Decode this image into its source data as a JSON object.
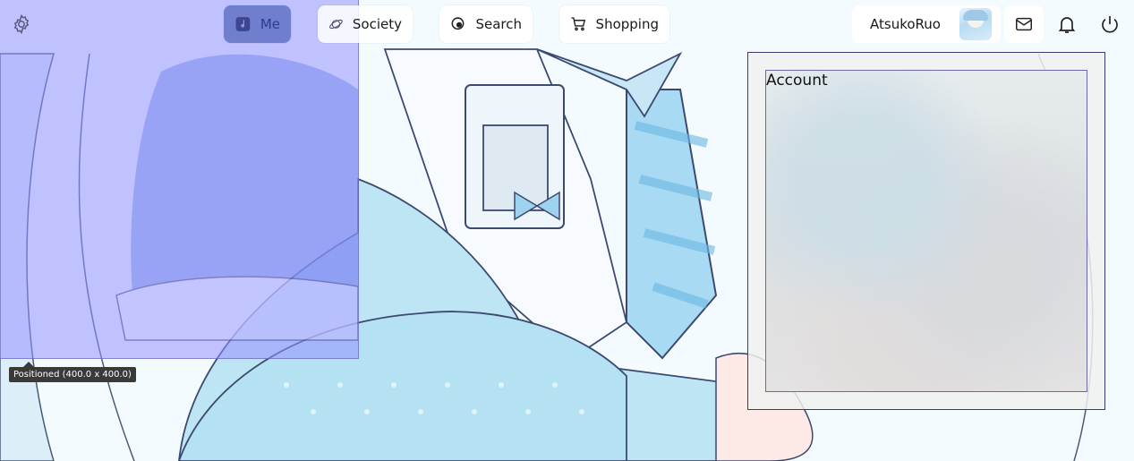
{
  "nav": {
    "items": [
      {
        "label": "Me",
        "icon": "music-note-icon",
        "active": true
      },
      {
        "label": "Society",
        "icon": "planet-icon",
        "active": false
      },
      {
        "label": "Search",
        "icon": "search-icon",
        "active": false
      },
      {
        "label": "Shopping",
        "icon": "cart-icon",
        "active": false
      }
    ]
  },
  "user": {
    "name": "AtsukoRuo"
  },
  "overlay": {
    "tooltip": "Positioned (400.0 x 400.0)"
  },
  "account": {
    "title": "Account"
  },
  "colors": {
    "accent": "#6f7fce",
    "overlay": "#9691ff",
    "panel_border": "#3e3a7a"
  }
}
